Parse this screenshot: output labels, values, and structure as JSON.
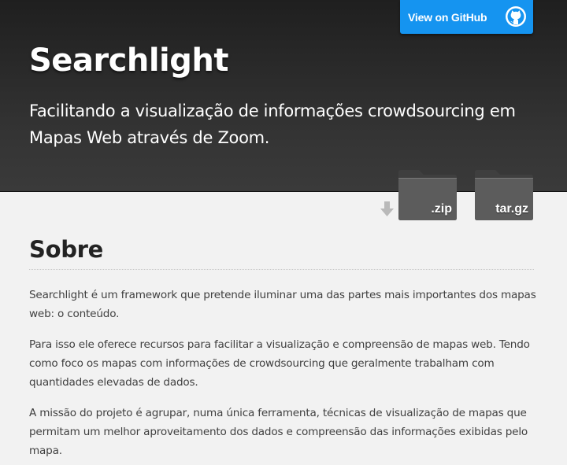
{
  "header": {
    "github_button_label": "View on GitHub",
    "github_icon": "github-octocat-icon",
    "title": "Searchlight",
    "tagline": "Facilitando a visualização de informações crowdsourcing em Mapas Web através de Zoom."
  },
  "downloads": {
    "arrow_icon": "download-arrow-icon",
    "zip_label": ".zip",
    "tar_label": "tar.gz"
  },
  "main": {
    "section_title": "Sobre",
    "paragraphs": [
      "Searchlight é um framework que pretende iluminar uma das partes mais importantes dos mapas web: o conteúdo.",
      "Para isso ele oferece recursos para facilitar a visualização e compreensão de mapas web. Tendo como foco os mapas com informações de crowdsourcing que geralmente trabalham com quantidades elevadas de dados.",
      "A missão do projeto é agrupar, numa única ferramenta, técnicas de visualização de mapas que permitam um melhor aproveitamento dos dados e compreensão das informações exibidas pelo mapa."
    ]
  },
  "colors": {
    "header_bg": "#2b2b2b",
    "github_button": "#1594f0",
    "page_bg": "#f2f2f2",
    "folder": "#555555"
  }
}
